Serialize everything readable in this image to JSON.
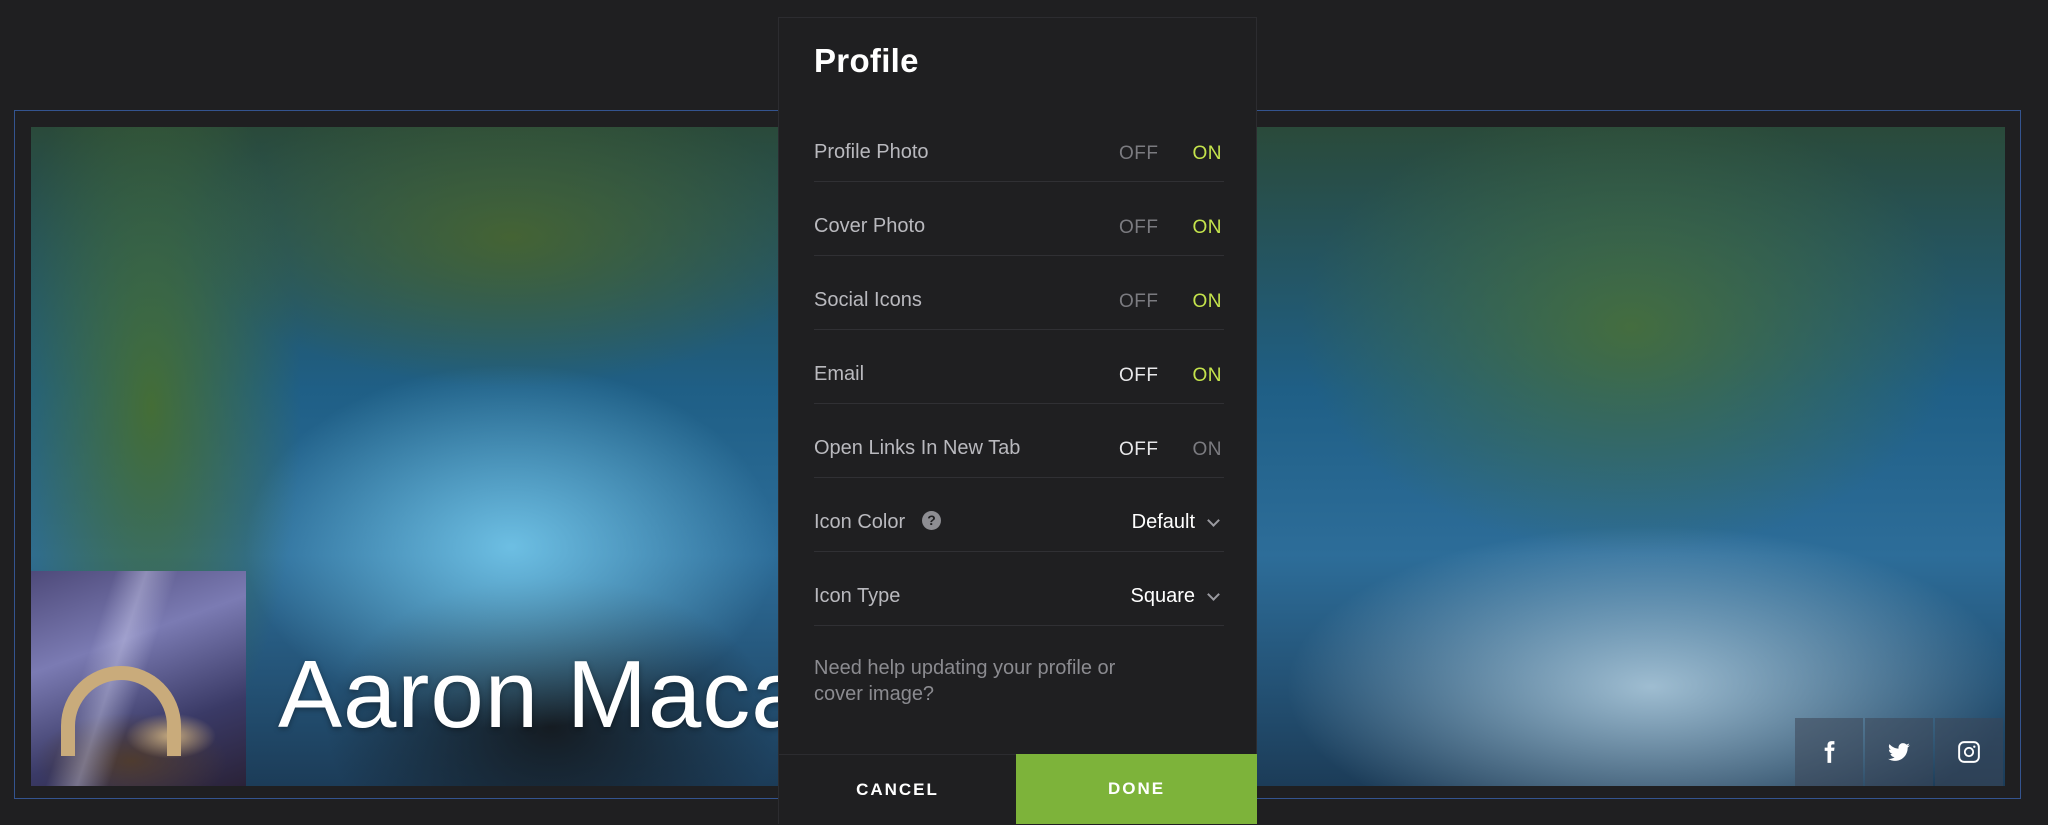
{
  "cover": {
    "name": "Aaron Maca"
  },
  "social": {
    "items": [
      {
        "icon": "facebook-icon"
      },
      {
        "icon": "twitter-icon"
      },
      {
        "icon": "instagram-icon"
      }
    ]
  },
  "modal": {
    "title": "Profile",
    "toggles": [
      {
        "label": "Profile Photo",
        "off": "OFF",
        "on": "ON",
        "state": "on"
      },
      {
        "label": "Cover Photo",
        "off": "OFF",
        "on": "ON",
        "state": "on"
      },
      {
        "label": "Social Icons",
        "off": "OFF",
        "on": "ON",
        "state": "on"
      },
      {
        "label": "Email",
        "off": "OFF",
        "on": "ON",
        "state": "on"
      },
      {
        "label": "Open Links In New Tab",
        "off": "OFF",
        "on": "ON",
        "state": "off"
      }
    ],
    "icon_color": {
      "label": "Icon Color",
      "help": "?",
      "value": "Default"
    },
    "icon_type": {
      "label": "Icon Type",
      "value": "Square"
    },
    "help_text": "Need help updating your profile or cover image?",
    "cancel_label": "CANCEL",
    "done_label": "DONE"
  },
  "colors": {
    "accent_on": "#c4e34c",
    "done_button": "#7db33a",
    "background": "#1f1f21"
  }
}
